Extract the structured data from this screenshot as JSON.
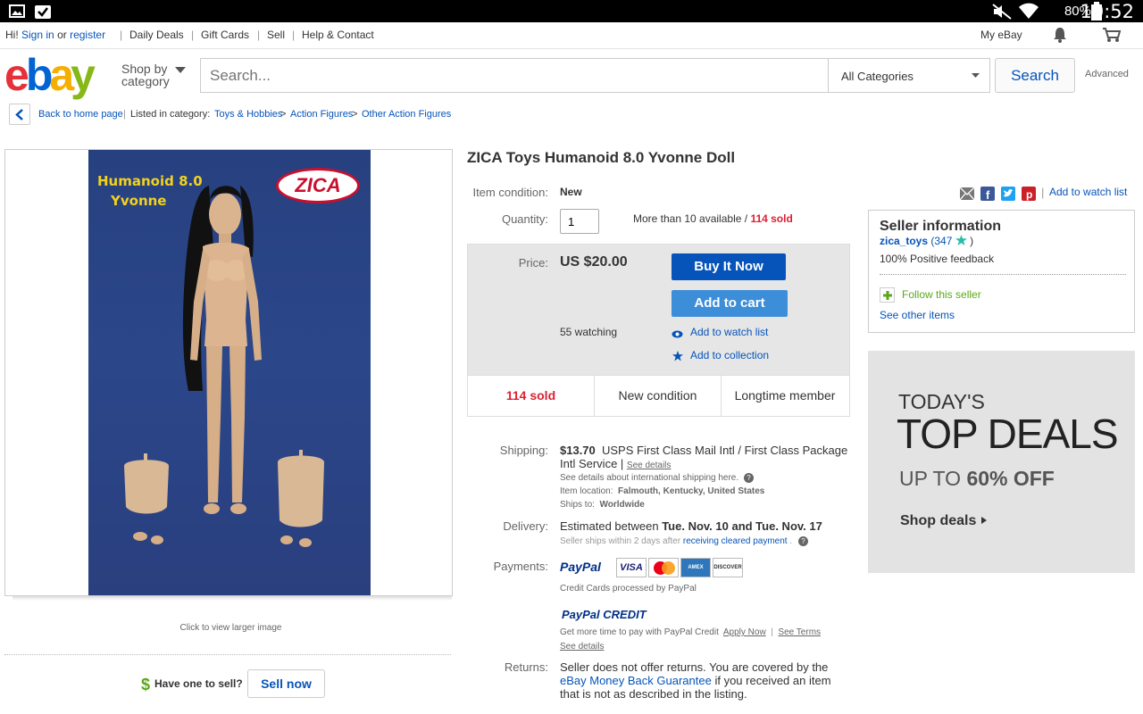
{
  "status_bar": {
    "battery": "80%",
    "time": "10:52"
  },
  "top_links": {
    "greeting": "Hi!",
    "sign_in": "Sign in",
    "or": "or",
    "register": "register",
    "daily_deals": "Daily Deals",
    "gift_cards": "Gift Cards",
    "sell": "Sell",
    "help": "Help & Contact",
    "my_ebay": "My eBay"
  },
  "header": {
    "logo": [
      "e",
      "b",
      "a",
      "y"
    ],
    "shop_by_1": "Shop by",
    "shop_by_2": "category",
    "search_placeholder": "Search...",
    "category": "All Categories",
    "search_button": "Search",
    "advanced": "Advanced"
  },
  "breadcrumb": {
    "back": "Back to home page",
    "listed_in": "Listed in category:",
    "crumbs": [
      "Toys & Hobbies",
      "Action Figures",
      "Other Action Figures"
    ]
  },
  "image": {
    "title_line1": "Humanoid 8.0",
    "title_line2": "Yvonne",
    "brand": "ZICA",
    "caption": "Click to view larger image"
  },
  "sell_promo": {
    "question": "Have one to sell?",
    "button": "Sell now"
  },
  "item": {
    "title": "ZICA Toys Humanoid 8.0 Yvonne Doll",
    "condition_label": "Item condition:",
    "condition": "New",
    "quantity_label": "Quantity:",
    "quantity_value": "1",
    "available": "More than 10 available /",
    "sold_inline": "114 sold",
    "watch_list_top": "Add to watch list"
  },
  "pricing": {
    "price_label": "Price:",
    "price": "US $20.00",
    "buy_now": "Buy It Now",
    "add_to_cart": "Add to cart",
    "watching": "55 watching",
    "add_watch": "Add to watch list",
    "add_collection": "Add to collection",
    "badges": [
      "114 sold",
      "New condition",
      "Longtime member"
    ]
  },
  "shipping": {
    "label": "Shipping:",
    "cost": "$13.70",
    "service": "USPS First Class Mail Intl / First Class Package Intl Service |",
    "see_details": "See details",
    "intl_note": "See details about international shipping here.",
    "location_label": "Item location:",
    "location": "Falmouth, Kentucky, United States",
    "ships_to_label": "Ships to:",
    "ships_to": "Worldwide"
  },
  "delivery": {
    "label": "Delivery:",
    "estimated": "Estimated between",
    "range": "Tue. Nov. 10 and Tue. Nov. 17",
    "note_prefix": "Seller ships within 2 days after",
    "note_link": "receiving cleared payment",
    "note_suffix": "."
  },
  "payments": {
    "label": "Payments:",
    "paypal": "PayPal",
    "cards": [
      "VISA",
      "MC",
      "AMEX",
      "DISCOVER"
    ],
    "processed": "Credit Cards processed by PayPal",
    "credit_brand": "PayPal CREDIT",
    "credit_text": "Get more time to pay with PayPal Credit",
    "apply": "Apply Now",
    "see_terms": "See Terms",
    "see_details": "See details"
  },
  "returns": {
    "label": "Returns:",
    "text1": "Seller does not offer returns. You are covered by the",
    "guarantee": "eBay Money Back Guarantee",
    "text2": "if you received an item",
    "text3": "that is not as described in the listing."
  },
  "seller": {
    "heading": "Seller information",
    "name": "zica_toys",
    "score": "(347",
    "score_end": ")",
    "feedback": "100% Positive feedback",
    "follow": "Follow this seller",
    "other_items": "See other items"
  },
  "deals": {
    "line1": "TODAY'S",
    "line2": "TOP DEALS",
    "line3_prefix": "UP TO",
    "line3_strong": "60% OFF",
    "cta": "Shop deals"
  },
  "colors": {
    "ebay_red": "#e53238",
    "ebay_blue": "#0064d2",
    "ebay_yellow": "#f5af02",
    "ebay_green": "#86b817",
    "sold_red": "#dd1e31"
  }
}
